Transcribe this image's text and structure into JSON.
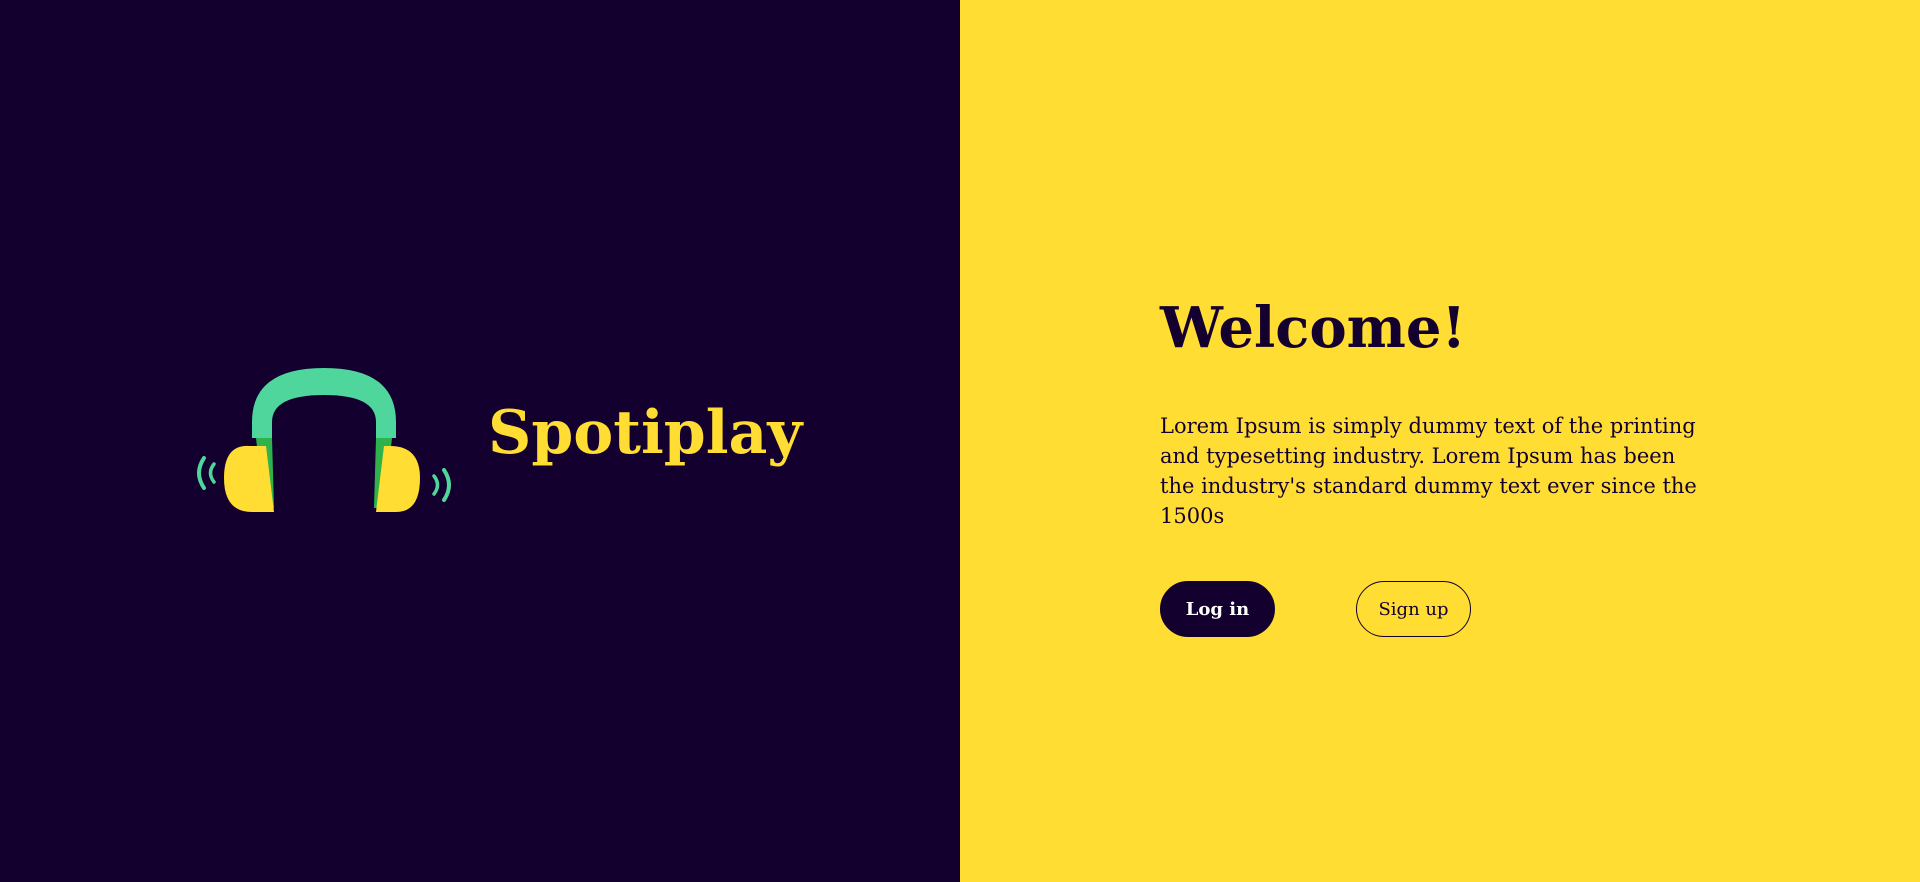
{
  "brand": {
    "name": "Spotiplay",
    "logo_icon": "headphones-icon"
  },
  "welcome": {
    "title": "Welcome!",
    "description": "Lorem Ipsum is simply dummy text of the printing and typesetting industry. Lorem Ipsum has been the industry's standard dummy text ever since the 1500s"
  },
  "actions": {
    "login_label": "Log in",
    "signup_label": "Sign up"
  },
  "colors": {
    "dark": "#13002f",
    "yellow": "#ffdd33",
    "green": "#4fd69c",
    "dark_green": "#2fb24c"
  }
}
